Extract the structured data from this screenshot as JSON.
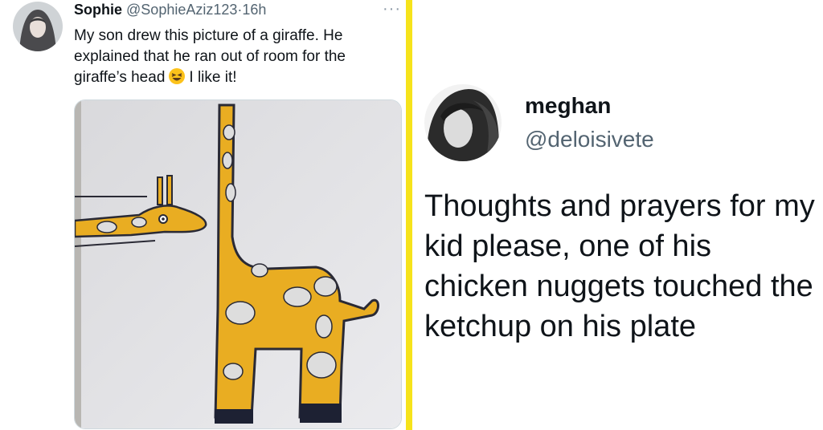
{
  "left_tweet": {
    "display_name": "Sophie",
    "handle": "@SophieAziz123",
    "separator": "·",
    "time": "16h",
    "more": "···",
    "text_before_emoji": "My son drew this picture of a giraffe. He explained that he ran out of room for the giraffe’s head",
    "emoji": "grinning-squinting-face",
    "text_after_emoji": "I like it!"
  },
  "right_tweet": {
    "display_name": "meghan",
    "handle": "@deloisivete",
    "text": "Thoughts and prayers for my kid please, one of his chicken nuggets touched the ketchup on his plate"
  },
  "colors": {
    "divider": "#f6e31b",
    "giraffe": "#e9ad22",
    "text": "#0f1419",
    "secondary": "#536471"
  }
}
